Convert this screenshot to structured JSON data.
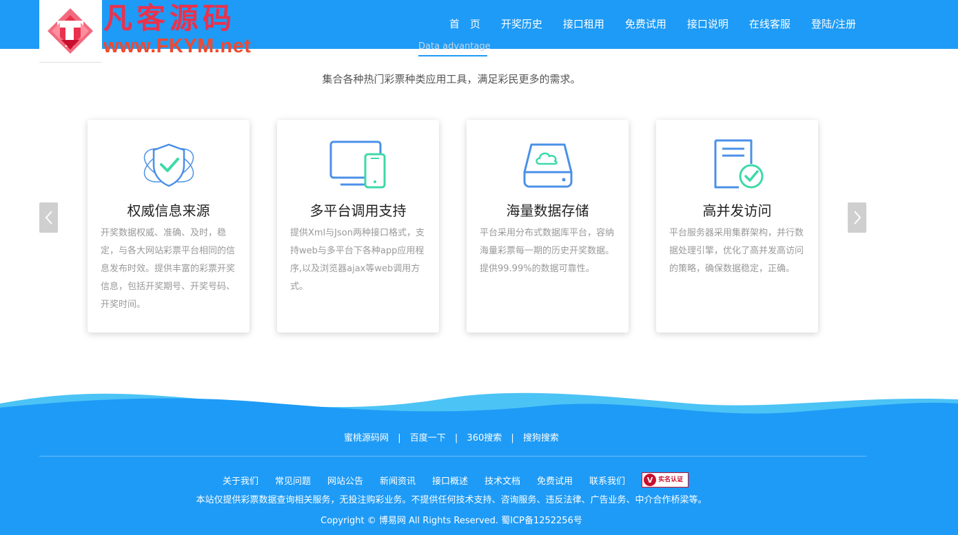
{
  "brand": {
    "title": "凡客源码",
    "url": "www.FKYM.net"
  },
  "nav": {
    "items": [
      "首　页",
      "开奖历史",
      "接口租用",
      "免费试用",
      "接口说明",
      "在线客服",
      "登陆/注册"
    ]
  },
  "section": {
    "subtitle": "Data advantage",
    "description": "集合各种热门彩票种类应用工具，满足彩民更多的需求。"
  },
  "cards": [
    {
      "icon": "shield-check-icon",
      "title": "权威信息来源",
      "text": "开奖数据权威、准确、及时，稳定，与各大网站彩票平台相同的信息发布时效。提供丰富的彩票开奖信息，包括开奖期号、开奖号码、开奖时间。"
    },
    {
      "icon": "devices-icon",
      "title": "多平台调用支持",
      "text": "提供Xml与Json两种接口格式，支持web与多平台下各种app应用程序,以及浏览器ajax等web调用方式。"
    },
    {
      "icon": "cloud-storage-icon",
      "title": "海量数据存储",
      "text": "平台采用分布式数据库平台，容纳海量彩票每一期的历史开奖数据。提供99.99%的数据可靠性。"
    },
    {
      "icon": "document-check-icon",
      "title": "高并发访问",
      "text": "平台服务器采用集群架构，并行数据处理引擎，优化了高并发高访问的策略，确保数据稳定，正确。"
    }
  ],
  "footer": {
    "friend_links": [
      "蜜桃源码网",
      "百度一下",
      "360搜索",
      "搜狗搜索"
    ],
    "separator": "|",
    "links": [
      "关于我们",
      "常见问题",
      "网站公告",
      "新闻资讯",
      "接口概述",
      "技术文档",
      "免费试用",
      "联系我们"
    ],
    "badge": {
      "letter": "V",
      "label": "实名认证"
    },
    "notice": "本站仅提供彩票数据查询相关服务，无投注购彩业务。不提供任何技术支持、咨询服务、违反法律、广告业务、中介合作桥梁等。",
    "copyright": "Copyright © 博易网 All Rights Reserved. 蜀ICP备1252256号"
  },
  "colors": {
    "primary": "#1e9bf6",
    "wave_light": "#4cc3f5",
    "logo_red": "#e9324d",
    "icon_blue": "#4a90e8",
    "icon_green": "#3dd9a8"
  }
}
